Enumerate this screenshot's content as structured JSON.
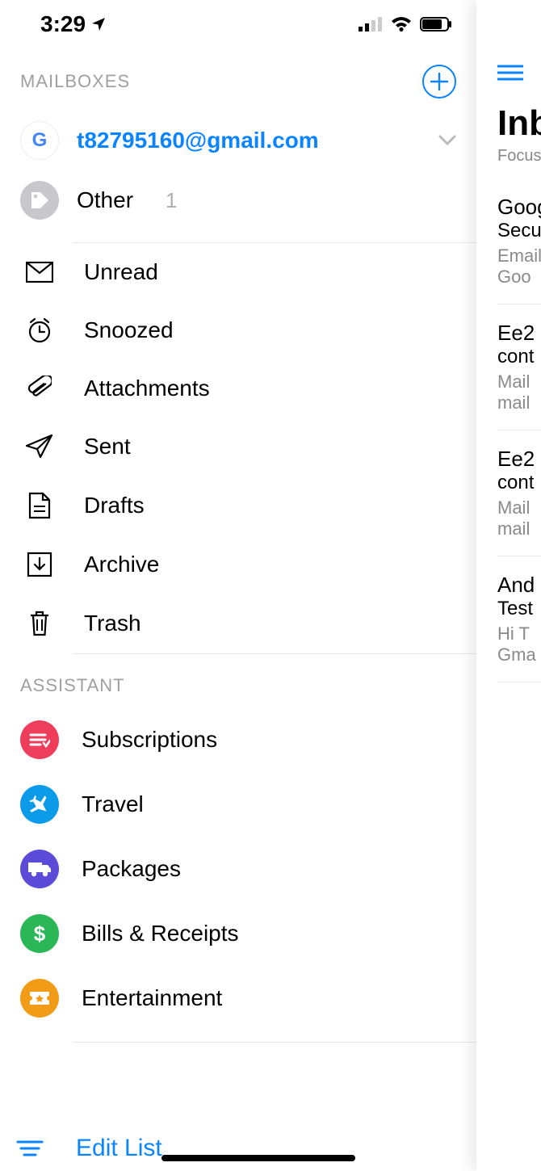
{
  "status": {
    "time": "3:29"
  },
  "sidebar": {
    "header_label": "MAILBOXES",
    "account": {
      "email": "t82795160@gmail.com"
    },
    "other": {
      "label": "Other",
      "count": "1"
    },
    "folders": [
      {
        "label": "Unread"
      },
      {
        "label": "Snoozed"
      },
      {
        "label": "Attachments"
      },
      {
        "label": "Sent"
      },
      {
        "label": "Drafts"
      },
      {
        "label": "Archive"
      },
      {
        "label": "Trash"
      }
    ],
    "assistant_label": "ASSISTANT",
    "assistant": [
      {
        "label": "Subscriptions",
        "color": "#ef3e5b"
      },
      {
        "label": "Travel",
        "color": "#0b9be8"
      },
      {
        "label": "Packages",
        "color": "#5c4bd8"
      },
      {
        "label": "Bills & Receipts",
        "color": "#2bb658"
      },
      {
        "label": "Entertainment",
        "color": "#f29b17"
      }
    ],
    "edit_label": "Edit List"
  },
  "peek": {
    "title": "Inbox",
    "subtitle": "Focused",
    "messages": [
      {
        "from": "Google",
        "subj": "Security",
        "p1": "Email",
        "p2": "Goo"
      },
      {
        "from": "Ee2",
        "subj": "cont",
        "p1": "Mail",
        "p2": "mail"
      },
      {
        "from": "Ee2",
        "subj": "cont",
        "p1": "Mail",
        "p2": "mail"
      },
      {
        "from": "And",
        "subj": "Test",
        "p1": "Hi T",
        "p2": "Gma"
      }
    ]
  }
}
